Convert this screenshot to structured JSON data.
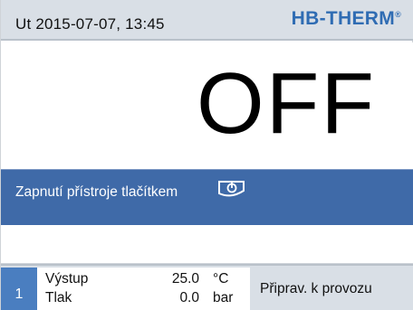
{
  "header": {
    "datetime": "Ut  2015-07-07, 13:45",
    "brand": "HB-THERM",
    "brand_mark": "®"
  },
  "main": {
    "state": "OFF"
  },
  "message": {
    "text": "Zapnutí přístroje tlačítkem",
    "icon": "power-key-icon"
  },
  "footer": {
    "unit_number": "1",
    "values": [
      {
        "label": "Výstup",
        "value": "25.0",
        "unit": "°C"
      },
      {
        "label": "Tlak",
        "value": "0.0",
        "unit": "bar"
      }
    ],
    "status": "Připrav. k provozu"
  },
  "colors": {
    "bar_gray": "#d9dfe6",
    "message_blue": "#3f6aa8",
    "badge_blue": "#4a7ec0",
    "brand_blue": "#2f6cb3"
  }
}
